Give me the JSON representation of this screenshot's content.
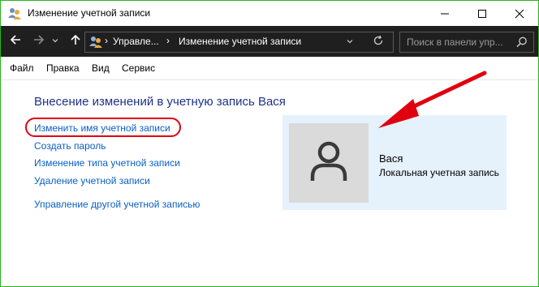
{
  "window": {
    "title": "Изменение учетной записи",
    "border_color": "#2bb21f"
  },
  "titlebar_icons": [
    "users-icon",
    "minimize-icon",
    "maximize-icon",
    "close-icon"
  ],
  "nav": {
    "back_icon": "arrow-left-icon",
    "forward_icon": "arrow-right-icon",
    "history_icon": "chevron-down-icon",
    "up_icon": "arrow-up-icon",
    "breadcrumb": [
      "Управле...",
      "Изменение учетной записи"
    ],
    "refresh_icon": "refresh-icon",
    "search_placeholder": "Поиск в панели упр...",
    "search_icon": "search-icon"
  },
  "menu": [
    "Файл",
    "Правка",
    "Вид",
    "Сервис"
  ],
  "content": {
    "heading": "Внесение изменений в учетную запись Вася",
    "links": [
      "Изменить имя учетной записи",
      "Создать пароль",
      "Изменение типа учетной записи",
      "Удаление учетной записи",
      "Управление другой учетной записью"
    ],
    "highlight_color": "#e0000f"
  },
  "user": {
    "name": "Вася",
    "type": "Локальная учетная запись",
    "panel_color": "#e5f1fb",
    "avatar_icon": "user-avatar-icon"
  },
  "annotation": {
    "arrow_icon": "red-arrow-icon",
    "color": "#e0000f"
  }
}
